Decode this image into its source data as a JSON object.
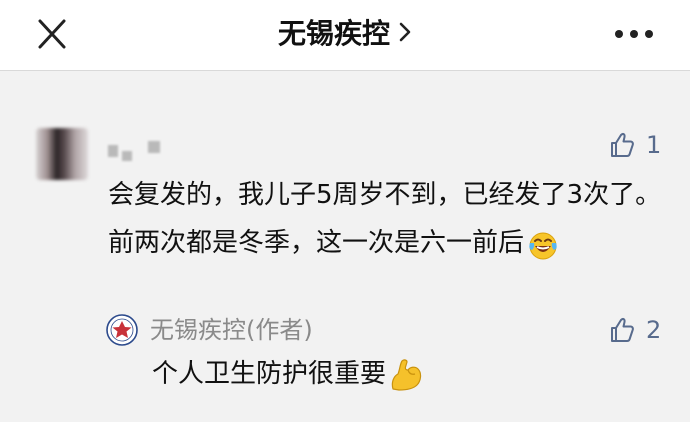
{
  "header": {
    "title": "无锡疾控",
    "close_icon": "close-icon",
    "chevron_icon": "chevron-right-icon",
    "more_icon": "more-dots-icon"
  },
  "comment": {
    "username": "",
    "text": "会复发的，我儿子5周岁不到，已经发了3次了。前两次都是冬季，这一次是六一前后",
    "emoji": "tears-of-joy-emoji",
    "likes": "1"
  },
  "reply": {
    "author": "无锡疾控(作者)",
    "text": "个人卫生防护很重要",
    "emoji": "flexed-biceps-emoji",
    "likes": "2"
  },
  "colors": {
    "accent": "#586b8d",
    "background": "#f2f2f2",
    "author_gray": "#8a8a8a"
  }
}
